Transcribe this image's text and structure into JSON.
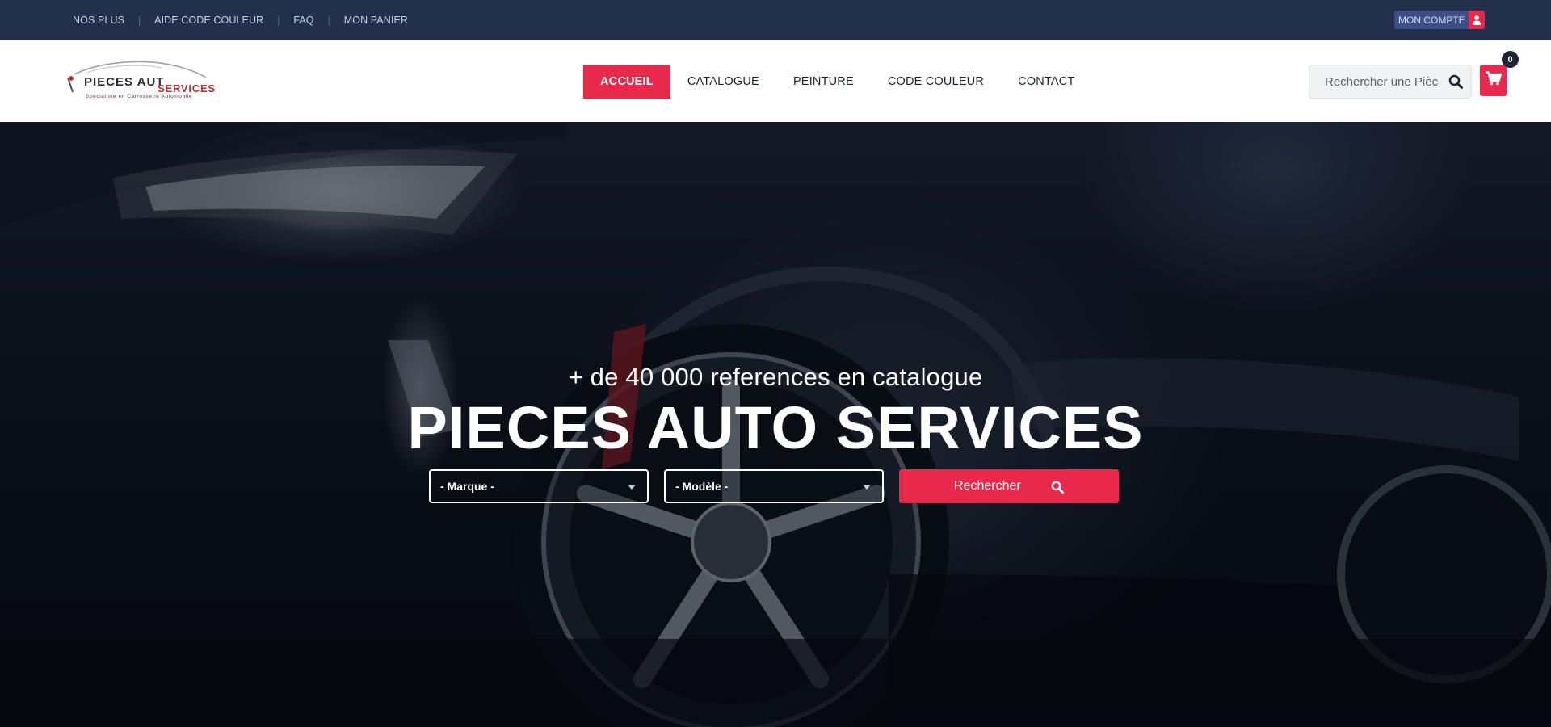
{
  "topbar": {
    "links": [
      "NOS PLUS",
      "AIDE CODE COULEUR",
      "FAQ",
      "MON PANIER"
    ],
    "separator": "|",
    "account_label": "MON COMPTE"
  },
  "header": {
    "logo": {
      "line1": "PIECES AUT",
      "line2": "SERVICES",
      "tagline": "Spécialiste en Carrosserie Automobile"
    },
    "nav": [
      "ACCUEIL",
      "CATALOGUE",
      "PEINTURE",
      "CODE COULEUR",
      "CONTACT"
    ],
    "active_nav": "ACCUEIL",
    "search_placeholder": "Rechercher une Pièce",
    "cart_count": "0"
  },
  "hero": {
    "subtitle": "+ de 40 000 references en catalogue",
    "title": "PIECES AUTO SERVICES",
    "brand_select": "- Marque -",
    "model_select": "- Modèle -",
    "search_button": "Rechercher"
  },
  "colors": {
    "accent": "#e8294c",
    "topbar": "#23304c",
    "account_bg": "#3d4f86"
  },
  "icons": [
    "user-icon",
    "search-icon",
    "cart-icon",
    "chevron-down-icon"
  ]
}
